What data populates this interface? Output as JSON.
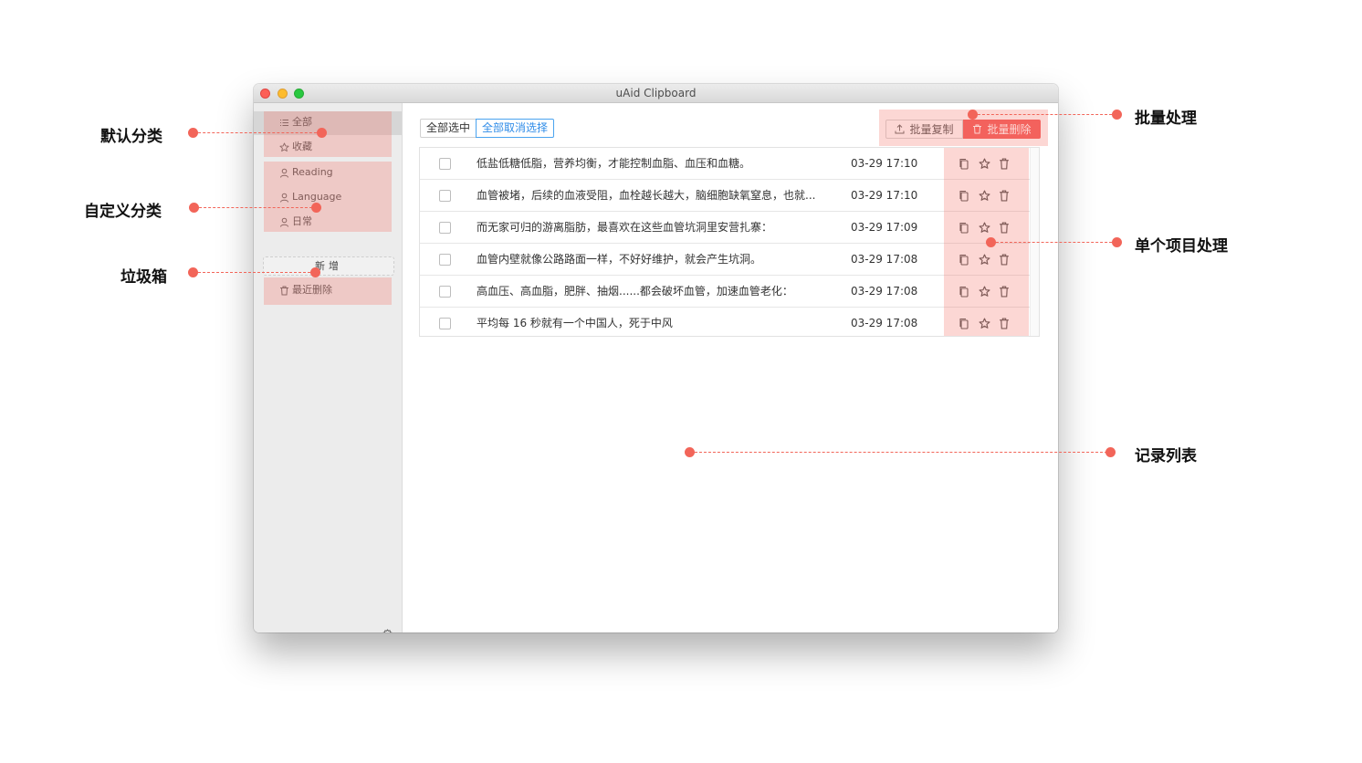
{
  "window": {
    "title": "uAid Clipboard"
  },
  "sidebar": {
    "default_items": [
      {
        "label": "全部",
        "icon": "list-icon"
      },
      {
        "label": "收藏",
        "icon": "star-icon"
      }
    ],
    "custom_items": [
      {
        "label": "Reading",
        "icon": "user-icon"
      },
      {
        "label": "Language",
        "icon": "user-icon"
      },
      {
        "label": "日常",
        "icon": "user-icon"
      }
    ],
    "add_label": "新增",
    "trash": {
      "label": "最近删除",
      "icon": "trash-icon"
    }
  },
  "toolbar": {
    "select_all": "全部选中",
    "deselect_all": "全部取消选择",
    "bulk_copy": "批量复制",
    "bulk_delete": "批量删除"
  },
  "records": [
    {
      "text": "低盐低糖低脂，营养均衡，才能控制血脂、血压和血糖。",
      "time": "03-29 17:10"
    },
    {
      "text": "血管被堵，后续的血液受阻，血栓越长越大，脑细胞缺氧窒息，也就...",
      "time": "03-29 17:10"
    },
    {
      "text": "而无家可归的游离脂肪，最喜欢在这些血管坑洞里安营扎寨：",
      "time": "03-29 17:09"
    },
    {
      "text": "血管内壁就像公路路面一样，不好好维护，就会产生坑洞。",
      "time": "03-29 17:08"
    },
    {
      "text": "高血压、高血脂，肥胖、抽烟......都会破坏血管，加速血管老化：",
      "time": "03-29 17:08"
    },
    {
      "text": "平均每 16 秒就有一个中国人，死于中风",
      "time": "03-29 17:08"
    }
  ],
  "annotations": {
    "default_category": "默认分类",
    "custom_category": "自定义分类",
    "trash": "垃圾箱",
    "bulk_processing": "批量处理",
    "single_item_processing": "单个项目处理",
    "record_list": "记录列表"
  },
  "colors": {
    "accent_blue": "#2f8ce8",
    "danger_red": "#f35d5a",
    "annotation_red": "#f26559",
    "highlight": "rgba(246,110,100,0.28)"
  }
}
